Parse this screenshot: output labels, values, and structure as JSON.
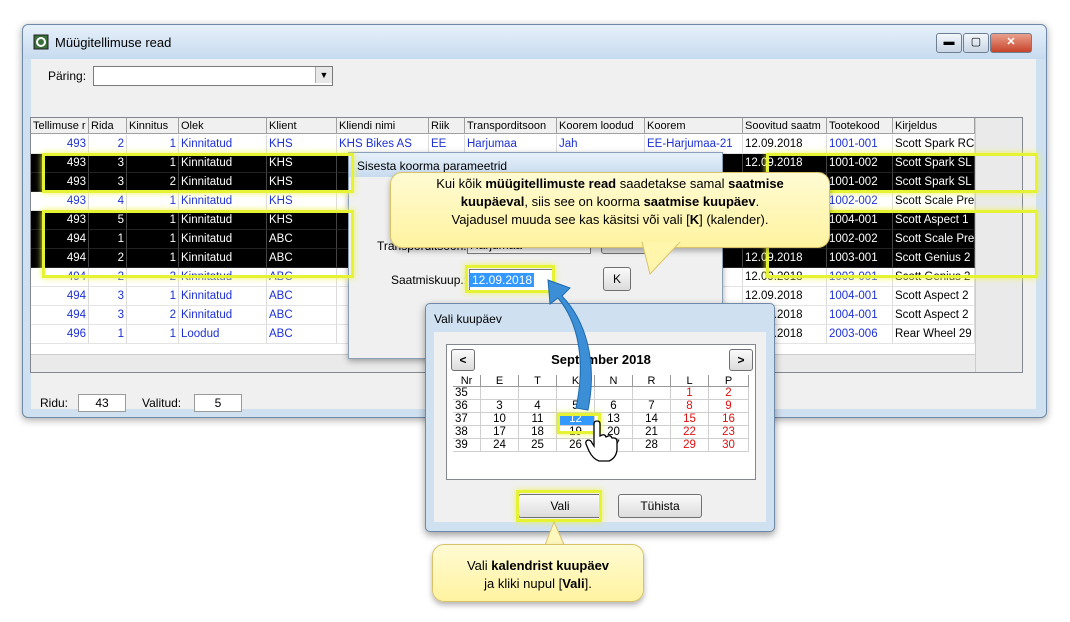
{
  "window": {
    "title": "Müügitellimuse read"
  },
  "query": {
    "label": "Päring:",
    "value": ""
  },
  "grid": {
    "columns": [
      "Tellimuse r",
      "Rida",
      "Kinnitus",
      "Olek",
      "Klient",
      "Kliendi nimi",
      "Riik",
      "Transporditsoon",
      "Koorem loodud",
      "Koorem",
      "Soovitud saatm",
      "Tootekood",
      "Kirjeldus"
    ],
    "rows": [
      {
        "order": "493",
        "line": "2",
        "conf": "1",
        "status": "Kinnitatud",
        "client": "KHS",
        "name": "KHS Bikes AS",
        "country": "EE",
        "zone": "Harjumaa",
        "created": "Jah",
        "load": "EE-Harjumaa-21",
        "date": "12.09.2018",
        "code": "1001-001",
        "desc": "Scott Spark RC"
      },
      {
        "order": "493",
        "line": "3",
        "conf": "1",
        "status": "Kinnitatud",
        "client": "KHS",
        "name": "",
        "country": "",
        "zone": "",
        "created": "",
        "load": "",
        "date": "12.09.2018",
        "code": "1001-002",
        "desc": "Scott Spark SL"
      },
      {
        "order": "493",
        "line": "3",
        "conf": "2",
        "status": "Kinnitatud",
        "client": "KHS",
        "name": "",
        "country": "",
        "zone": "",
        "created": "",
        "load": "",
        "date": "",
        "code": "1001-002",
        "desc": "Scott Spark SL"
      },
      {
        "order": "493",
        "line": "4",
        "conf": "1",
        "status": "Kinnitatud",
        "client": "KHS",
        "name": "",
        "country": "",
        "zone": "",
        "created": "",
        "load": "",
        "date": "",
        "code": "1002-002",
        "desc": "Scott Scale Pre"
      },
      {
        "order": "493",
        "line": "5",
        "conf": "1",
        "status": "Kinnitatud",
        "client": "KHS",
        "name": "",
        "country": "",
        "zone": "",
        "created": "",
        "load": "",
        "date": "",
        "code": "1004-001",
        "desc": "Scott Aspect 1"
      },
      {
        "order": "494",
        "line": "1",
        "conf": "1",
        "status": "Kinnitatud",
        "client": "ABC",
        "name": "",
        "country": "",
        "zone": "",
        "created": "",
        "load": "",
        "date": "",
        "code": "1002-002",
        "desc": "Scott Scale Pre"
      },
      {
        "order": "494",
        "line": "2",
        "conf": "1",
        "status": "Kinnitatud",
        "client": "ABC",
        "name": "",
        "country": "",
        "zone": "",
        "created": "",
        "load": "",
        "date": "12.09.2018",
        "code": "1003-001",
        "desc": "Scott Genius 2"
      },
      {
        "order": "494",
        "line": "2",
        "conf": "2",
        "status": "Kinnitatud",
        "client": "ABC",
        "name": "",
        "country": "",
        "zone": "",
        "created": "",
        "load": "maa-22",
        "date": "12.09.2018",
        "code": "1003-001",
        "desc": "Scott Genius 2"
      },
      {
        "order": "494",
        "line": "3",
        "conf": "1",
        "status": "Kinnitatud",
        "client": "ABC",
        "name": "",
        "country": "",
        "zone": "",
        "created": "",
        "load": "",
        "date": "12.09.2018",
        "code": "1004-001",
        "desc": "Scott Aspect 2"
      },
      {
        "order": "494",
        "line": "3",
        "conf": "2",
        "status": "Kinnitatud",
        "client": "ABC",
        "name": "",
        "country": "",
        "zone": "",
        "created": "",
        "load": "",
        "date": "12.09.2018",
        "code": "1004-001",
        "desc": "Scott Aspect 2"
      },
      {
        "order": "496",
        "line": "1",
        "conf": "1",
        "status": "Loodud",
        "client": "ABC",
        "name": "",
        "country": "",
        "zone": "",
        "created": "",
        "load": "",
        "date": "20.09.2018",
        "code": "2003-006",
        "desc": "Rear Wheel 29"
      }
    ]
  },
  "statusbar": {
    "rows_label": "Ridu:",
    "rows_value": "43",
    "selected_label": "Valitud:",
    "selected_value": "5"
  },
  "dialog_load": {
    "title": "Sisesta koorma parameetrid",
    "zone_label": "Transporditsoon:",
    "zone_value": "Harjumaa",
    "list_label": "Nimekiri",
    "date_label": "Saatmiskuup.:",
    "date_value": "12.09.2018",
    "calendar_button": "K"
  },
  "dialog_calendar": {
    "title": "Vali kuupäev",
    "prev": "<",
    "next": ">",
    "month": "September 2018",
    "headers": [
      "Nr",
      "E",
      "T",
      "K",
      "N",
      "R",
      "L",
      "P"
    ],
    "weeks": [
      [
        "35",
        "",
        "",
        "",
        "",
        "",
        "1",
        "2"
      ],
      [
        "36",
        "3",
        "4",
        "5",
        "6",
        "7",
        "8",
        "9"
      ],
      [
        "37",
        "10",
        "11",
        "12",
        "13",
        "14",
        "15",
        "16"
      ],
      [
        "38",
        "17",
        "18",
        "19",
        "20",
        "21",
        "22",
        "23"
      ],
      [
        "39",
        "24",
        "25",
        "26",
        "27",
        "28",
        "29",
        "30"
      ]
    ],
    "ok": "Vali",
    "cancel": "Tühista"
  },
  "callout_top": {
    "l1a": "Kui kõik ",
    "l1b": "müügitellimuste read",
    "l1c": " saadetakse samal ",
    "l1d": "saatmise",
    "l2a": "kuupäeval",
    "l2b": ", siis see on koorma ",
    "l2c": "saatmise kuupäev",
    "l2d": ".",
    "l3a": "Vajadusel muuda see kas käsitsi või vali [",
    "l3b": "K",
    "l3c": "] (kalender)."
  },
  "callout_bottom": {
    "l1a": "Vali ",
    "l1b": "kalendrist kuupäev",
    "l2a": "ja kliki nupul [",
    "l2b": "Vali",
    "l2c": "]."
  },
  "colors": {
    "highlight": "#e6f234",
    "link": "#1c30d6",
    "weekend": "#e01010",
    "callout": "#fff3a0"
  }
}
